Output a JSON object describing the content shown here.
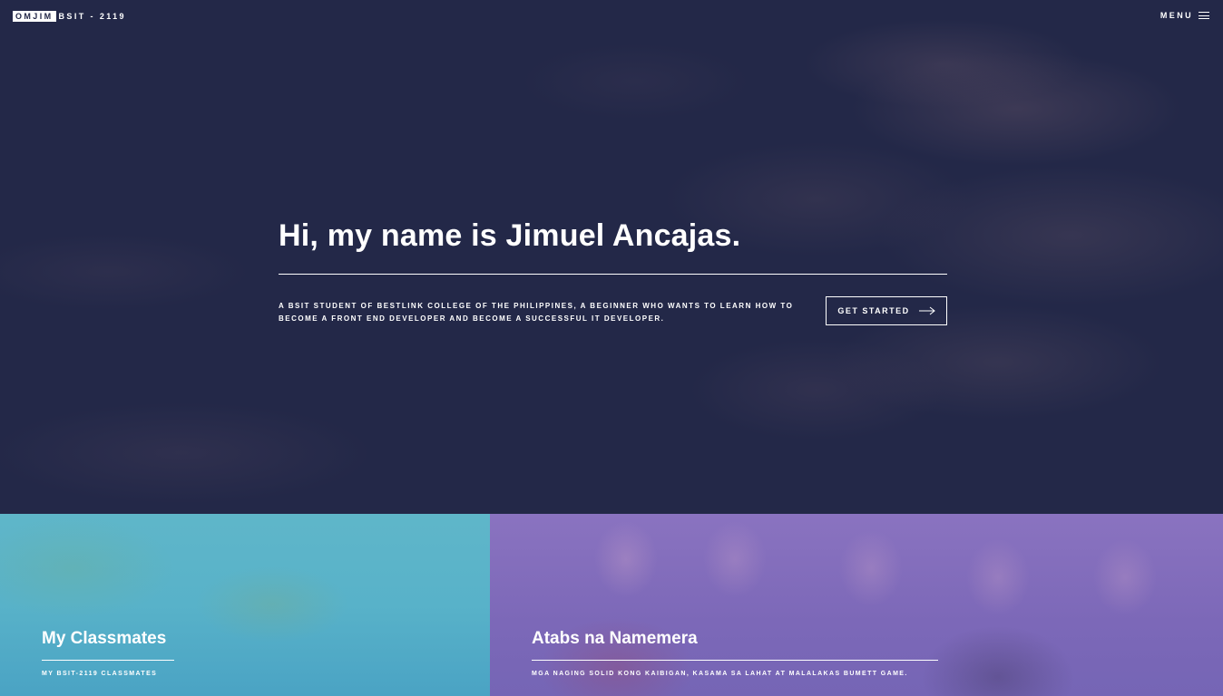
{
  "header": {
    "brand_box": "OMJIM",
    "brand_text": "BSIT - 2119",
    "menu_label": "MENU"
  },
  "hero": {
    "headline": "Hi, my name is Jimuel Ancajas.",
    "tagline": "A BSIT STUDENT OF BESTLINK COLLEGE OF THE PHILIPPINES, A BEGINNER WHO WANTS TO LEARN HOW TO BECOME A FRONT END DEVELOPER AND BECOME A SUCCESSFUL IT DEVELOPER.",
    "cta_label": "GET STARTED"
  },
  "cards": [
    {
      "title": "My Classmates",
      "subtitle": "MY BSIT-2119 CLASSMATES"
    },
    {
      "title": "Atabs na Namemera",
      "subtitle": "MGA NAGING SOLID KONG KAIBIGAN, KASAMA SA LAHAT AT MALALAKAS BUMETT GAME."
    }
  ]
}
